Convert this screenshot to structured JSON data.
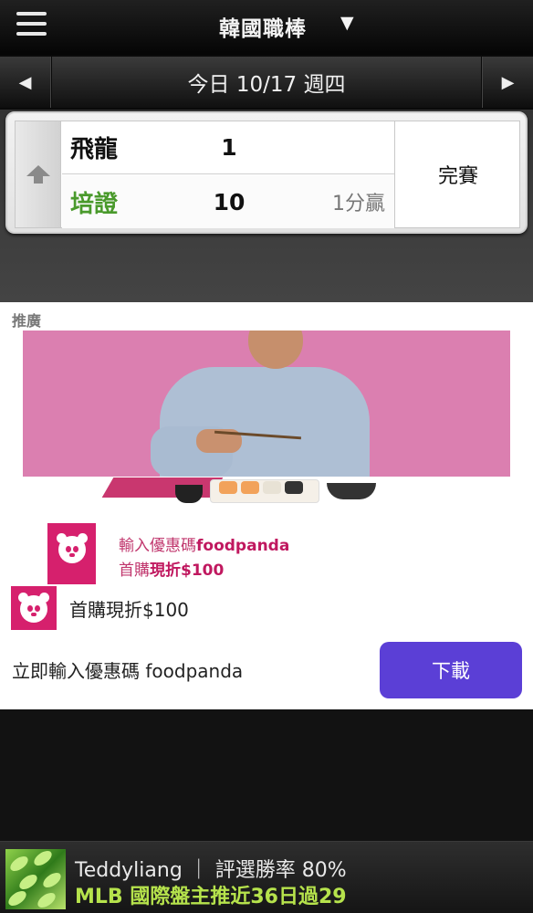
{
  "header": {
    "title": "韓國職棒",
    "menu_icon": "hamburger-menu-icon",
    "dropdown_icon": "caret-down-icon"
  },
  "date_nav": {
    "prev_glyph": "◀",
    "next_glyph": "▶",
    "date_label": "今日 10/17 週四"
  },
  "game": {
    "collapse_icon": "arrow-up-icon",
    "teams": [
      {
        "name": "飛龍",
        "score": "1",
        "note": ""
      },
      {
        "name": "培證",
        "score": "10",
        "note": "1分贏"
      }
    ],
    "status": "完賽",
    "colors": {
      "winner": "#4a9a2c"
    }
  },
  "ad": {
    "label": "推廣",
    "promo_line1_prefix": "輸入優惠碼",
    "promo_line1_brand": "foodpanda",
    "promo_line2_prefix": "首購",
    "promo_line2_bold": "現折$100",
    "headline": "首購現折$100",
    "cta_text": "立即輸入優惠碼 foodpanda",
    "download_label": "下載",
    "colors": {
      "brand_pink": "#d6206d",
      "button": "#5b3fd6"
    }
  },
  "bottom_banner": {
    "line1": "Teddyliang ｜ 評選勝率 80%",
    "line2": "MLB 國際盤主推近36日過29",
    "colors": {
      "highlight": "#b6e34c"
    }
  }
}
